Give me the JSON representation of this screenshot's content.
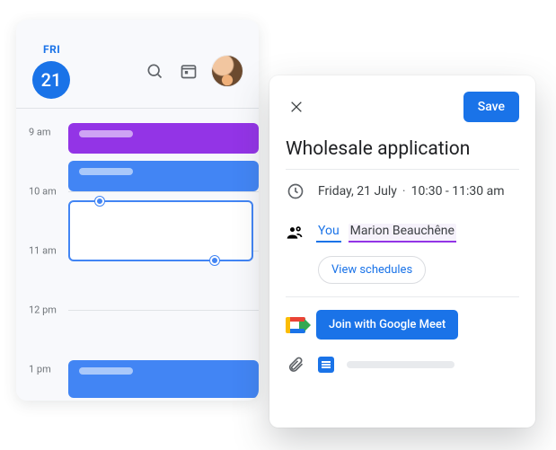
{
  "calendar": {
    "day_label": "FRI",
    "day_number": "21",
    "hours": [
      "9 am",
      "10 am",
      "11 am",
      "12 pm",
      "1 pm"
    ]
  },
  "detail": {
    "save_label": "Save",
    "title": "Wholesale application",
    "date_text": "Friday, 21 July",
    "time_text": "10:30 - 11:30 am",
    "you_label": "You",
    "guest_name": "Marion Beauchêne",
    "view_schedules_label": "View schedules",
    "meet_label": "Join with Google Meet"
  }
}
